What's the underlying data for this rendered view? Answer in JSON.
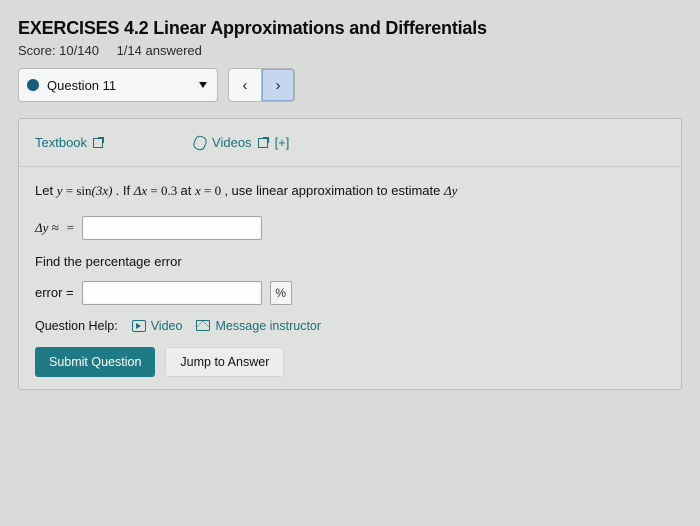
{
  "header": {
    "title": "EXERCISES 4.2 Linear Approximations and Differentials",
    "score_label": "Score: 10/140",
    "answered_label": "1/14 answered"
  },
  "questionSelector": {
    "current": "Question 11"
  },
  "resources": {
    "textbook": "Textbook",
    "videos": "Videos",
    "expand": "[+]"
  },
  "problem": {
    "prefix": "Let ",
    "eq1_lhs": "y",
    "eq1_rhs_func": "sin",
    "eq1_rhs_arg": "(3x)",
    "mid1": ". If ",
    "dx_sym": "Δx",
    "dx_val": "0.3",
    "mid2": " at ",
    "x_sym": "x",
    "x_val": "0",
    "mid3": ", use linear approximation to estimate ",
    "dy_sym": "Δy",
    "approx_label": "Δy ≈",
    "equals": "=",
    "find_error": "Find the percentage error",
    "error_label": "error =",
    "percent": "%"
  },
  "help": {
    "label": "Question Help:",
    "video": "Video",
    "message": "Message instructor"
  },
  "buttons": {
    "submit": "Submit Question",
    "jump": "Jump to Answer"
  }
}
